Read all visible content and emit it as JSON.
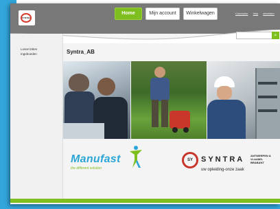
{
  "header": {
    "logo_text": "SYNTRA",
    "nav": {
      "home": "Home",
      "account": "Mijn account",
      "cart": "Winkelwagen"
    },
    "top_links": [
      "Conceptor",
      "help",
      "afmelden"
    ],
    "search": {
      "placeholder": "",
      "button": "⌕"
    }
  },
  "sidebar": {
    "items": [
      "Losse lettes",
      "Ingeboeden"
    ]
  },
  "main": {
    "title": "Syntra_AB",
    "logos": {
      "manufast_word": "Manufast",
      "manufast_tag": "the different solution",
      "syntra_ring": "SY",
      "syntra_word": "SYNTRA",
      "syntra_region_1": "ANTWERPEN &",
      "syntra_region_2": "VLAAMS-BRABANT",
      "syntra_tag": "uw opleiding-onze zaak"
    }
  },
  "colors": {
    "accent_green": "#7fbe1f",
    "brand_blue": "#33a6dc",
    "header_gray": "#787878"
  }
}
